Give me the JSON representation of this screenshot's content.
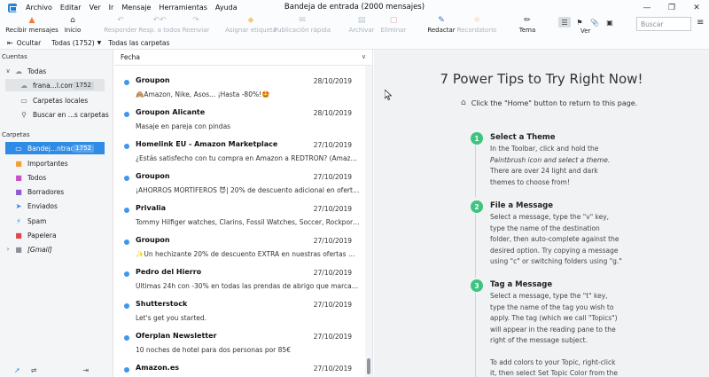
{
  "menu": {
    "items": [
      "Archivo",
      "Editar",
      "Ver",
      "Ir",
      "Mensaje",
      "Herramientas",
      "Ayuda"
    ],
    "window_title": "Bandeja de entrada (2000 mensajes)"
  },
  "toolbar": {
    "buttons": [
      {
        "label": "Recibir mensajes",
        "icon": "inbox-download-icon"
      },
      {
        "label": "Inicio",
        "icon": "home-icon"
      },
      {
        "label": "Responder",
        "icon": "reply-icon"
      },
      {
        "label": "Resp. a todos",
        "icon": "reply-all-icon"
      },
      {
        "label": "Reenviar",
        "icon": "forward-icon"
      },
      {
        "label": "Asignar etiqueta",
        "icon": "tag-icon"
      },
      {
        "label": "Publicación rápida",
        "icon": "quick-post-icon"
      },
      {
        "label": "Archivar",
        "icon": "archive-icon"
      },
      {
        "label": "Eliminar",
        "icon": "trash-icon"
      },
      {
        "label": "Redactar",
        "icon": "compose-icon"
      },
      {
        "label": "Recordatorio",
        "icon": "reminder-icon"
      },
      {
        "label": "Tema",
        "icon": "theme-brush-icon"
      },
      {
        "label": "Ver",
        "icon": "view-icon"
      }
    ],
    "search_placeholder": "Buscar"
  },
  "subbar": {
    "hide_label": "Ocultar",
    "filter_label": "Todas (1752)",
    "scope_label": "Todas las carpetas"
  },
  "sidebar": {
    "accounts_header": "Cuentas",
    "accounts": [
      {
        "label": "Todas",
        "icon": "cloud-icon"
      },
      {
        "label": "frana...l.com",
        "count": "1752",
        "icon": "cloud-icon"
      },
      {
        "label": "Carpetas locales",
        "icon": "local-folders-icon"
      },
      {
        "label": "Buscar en ...s carpetas",
        "icon": "search-icon"
      }
    ],
    "folders_header": "Carpetas",
    "folders": [
      {
        "label": "Bandej...ntrada",
        "count": "1752",
        "icon": "inbox-icon"
      },
      {
        "label": "Importantes",
        "icon": "important-icon"
      },
      {
        "label": "Todos",
        "icon": "all-mail-icon"
      },
      {
        "label": "Borradores",
        "icon": "drafts-icon"
      },
      {
        "label": "Enviados",
        "icon": "sent-icon"
      },
      {
        "label": "Spam",
        "icon": "spam-icon"
      },
      {
        "label": "Papelera",
        "icon": "trash-icon"
      },
      {
        "label": "[Gmail]",
        "icon": "folder-icon"
      }
    ]
  },
  "message_list": {
    "sort_label": "Fecha",
    "messages": [
      {
        "sender": "Groupon",
        "date": "28/10/2019",
        "subject": "🙈Amazon, Nike, Asos... ¡Hasta -80%!🤩"
      },
      {
        "sender": "Groupon Alicante",
        "date": "28/10/2019",
        "subject": "Masaje en pareja con pindas"
      },
      {
        "sender": "Homelink EU - Amazon Marketplace",
        "date": "27/10/2019",
        "subject": "¿Estás satisfecho con tu compra en Amazon a REDTRON? (Amazon Orde..."
      },
      {
        "sender": "Groupon",
        "date": "27/10/2019",
        "subject": "¡AHORROS MORTÍFEROS 😈| 20% de descuento adicional en ofertas ..."
      },
      {
        "sender": "Privalia",
        "date": "27/10/2019",
        "subject": "Tommy Hilfiger watches, Clarins, Fossil Watches, Soccer, Rockport y más."
      },
      {
        "sender": "Groupon",
        "date": "27/10/2019",
        "subject": "✨Un hechizante 20% de descuento EXTRA en nuestras ofertas más dese..."
      },
      {
        "sender": "Pedro del Hierro",
        "date": "27/10/2019",
        "subject": "Últimas 24h con -30% en todas las prendas de abrigo que marcan la dif..."
      },
      {
        "sender": "Shutterstock",
        "date": "27/10/2019",
        "subject": "Let's get you started."
      },
      {
        "sender": "Oferplan Newsletter",
        "date": "27/10/2019",
        "subject": "10 noches de hotel para dos personas por 85€"
      },
      {
        "sender": "Amazon.es",
        "date": "27/10/2019",
        "subject": ""
      }
    ]
  },
  "reader": {
    "title": "7 Power Tips to Try Right Now!",
    "home_hint": "Click the \"Home\" button to return to this page.",
    "tips": [
      {
        "num": "1",
        "title": "Select a Theme",
        "lines": [
          "In the Toolbar, click and hold the",
          "Paintbrush icon and select a theme.",
          "There are over 24 light and dark",
          "themes to choose from!"
        ]
      },
      {
        "num": "2",
        "title": "File a Message",
        "lines": [
          "Select a message, type the \"v\" key,",
          "type the name of the destination",
          "folder, then auto-complete against the",
          "desired option. Try copying a message",
          "using \"c\" or switching folders using \"g.\""
        ]
      },
      {
        "num": "3",
        "title": "Tag a Message",
        "lines": [
          "Select a message, type the \"t\" key,",
          "type the name of the tag you wish to",
          "apply. The tag (which we call \"Topics\")",
          "will appear in the reading pane to the",
          "right of the message subject.",
          "",
          "To add colors to your Topic, right-click",
          "it, then select Set Topic Color from the"
        ]
      }
    ]
  },
  "colors": {
    "accent": "#2f8be4",
    "unread_dot": "#3f97e8",
    "tip_badge": "#3ec47e"
  }
}
